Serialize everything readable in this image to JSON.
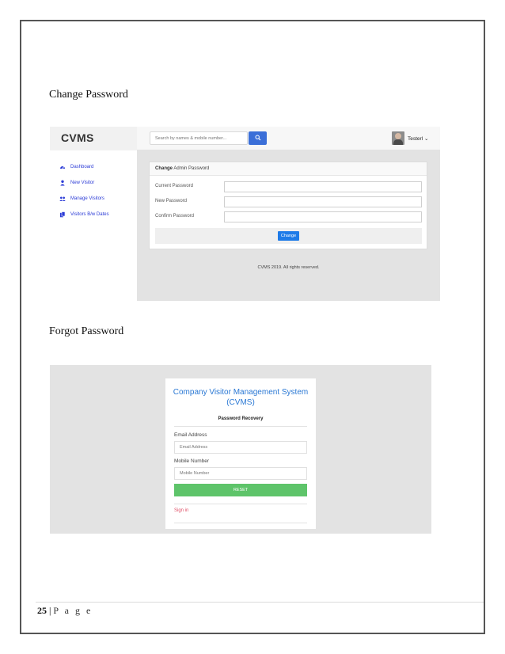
{
  "headings": {
    "change_password": "Change Password",
    "forgot_password": "Forgot Password"
  },
  "change_screen": {
    "brand": "CVMS",
    "search_placeholder": "Search by names & mobile number...",
    "user_name": "Testerl ⌄",
    "nav": [
      {
        "label": "Dashboard",
        "icon": "dashboard-icon"
      },
      {
        "label": "New Visitor",
        "icon": "user-icon"
      },
      {
        "label": "Manage Visitors",
        "icon": "users-icon"
      },
      {
        "label": "Visitors B/w Dates",
        "icon": "files-icon"
      }
    ],
    "card_title_bold": "Change",
    "card_title_rest": " Admin Password",
    "fields": [
      {
        "label": "Current Password"
      },
      {
        "label": "New Password"
      },
      {
        "label": "Confirm Password"
      }
    ],
    "button": "Change",
    "footer": "CVMS 2019. All rights reserved."
  },
  "forgot_screen": {
    "title": "Company Visitor Management System (CVMS)",
    "subtitle": "Password Recovery",
    "email_label": "Email Address",
    "email_placeholder": "Email Address",
    "mobile_label": "Mobile Number",
    "mobile_placeholder": "Mobile Number",
    "button": "RESET",
    "signin": "Sign in"
  },
  "page_footer": {
    "number": "25",
    "separator": " | ",
    "label": "P a g e"
  },
  "colors": {
    "accent_blue": "#2a78d4",
    "nav_blue": "#2a3ad6",
    "button_blue": "#1e7be8",
    "reset_green": "#5ec46a",
    "signin_red": "#e0526a"
  }
}
